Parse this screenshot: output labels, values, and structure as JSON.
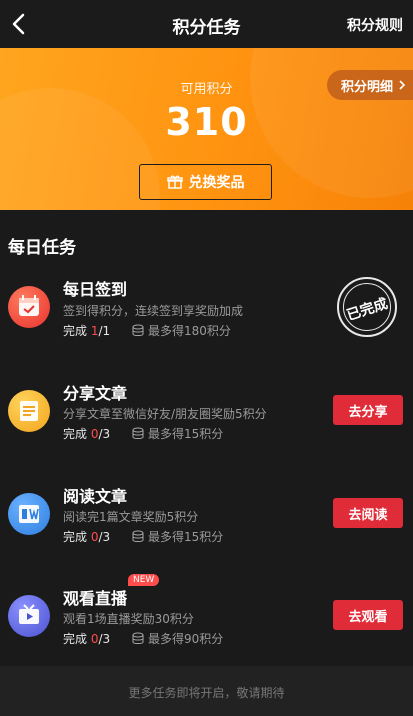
{
  "nav": {
    "title": "积分任务",
    "rules": "积分规则"
  },
  "points": {
    "label": "可用积分",
    "value": "310",
    "detail": "积分明细",
    "redeem": "兑换奖品"
  },
  "section": "每日任务",
  "tasks": [
    {
      "name": "每日签到",
      "desc": "签到得积分，连续签到享奖励加成",
      "done_label": "完成",
      "cur": "1",
      "total": "/1",
      "max": "最多得180积分",
      "status": "已完成",
      "icon": "calendar-check-icon",
      "color": "#f3483e"
    },
    {
      "name": "分享文章",
      "desc": "分享文章至微信好友/朋友圈奖励5积分",
      "done_label": "完成",
      "cur": "0",
      "total": "/3",
      "max": "最多得15积分",
      "button": "去分享",
      "icon": "document-icon",
      "color": "#f7b42a"
    },
    {
      "name": "阅读文章",
      "desc": "阅读完1篇文章奖励5积分",
      "done_label": "完成",
      "cur": "0",
      "total": "/3",
      "max": "最多得15积分",
      "button": "去阅读",
      "icon": "book-icon",
      "color": "#3d8fe8"
    },
    {
      "name": "观看直播",
      "desc": "观看1场直播奖励30积分",
      "done_label": "完成",
      "cur": "0",
      "total": "/3",
      "max": "最多得90积分",
      "button": "去观看",
      "icon": "tv-play-icon",
      "color": "#5b63d9",
      "badge": "NEW"
    }
  ],
  "footer": "更多任务即将开启，敬请期待"
}
